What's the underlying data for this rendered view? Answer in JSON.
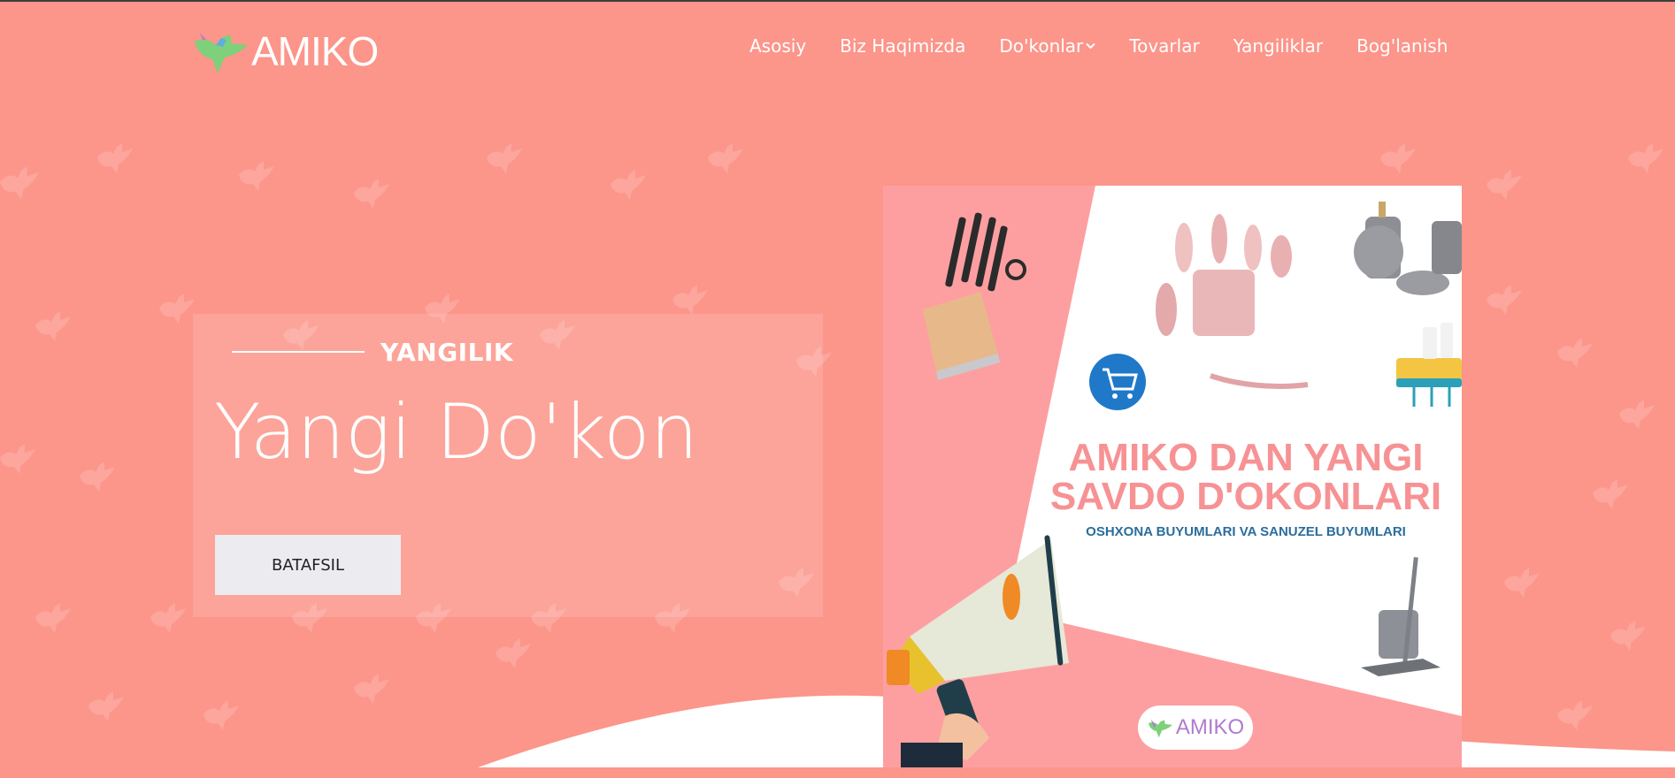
{
  "brand": {
    "logo_text": "AMIKO"
  },
  "nav": {
    "items": [
      {
        "label": "Asosiy"
      },
      {
        "label": "Biz Haqimizda"
      },
      {
        "label": "Do'konlar"
      },
      {
        "label": "Tovarlar"
      },
      {
        "label": "Yangiliklar"
      },
      {
        "label": "Bog'lanish"
      }
    ]
  },
  "hero": {
    "eyebrow": "YANGILIK",
    "title": "Yangi Do'kon",
    "button_label": "BATAFSIL"
  },
  "poster": {
    "headline_line1": "AMIKO DAN YANGI",
    "headline_line2": "SAVDO D'OKONLARI",
    "subline": "OSHXONA BUYUMLARI VA SANUZEL BUYUMLARI",
    "logo_text": "AMIKO"
  },
  "colors": {
    "background": "#fc958a",
    "poster_pink": "#fd9fa0",
    "headline": "#f79294",
    "subline": "#2a6d9c",
    "cart_blue": "#1f79c8"
  }
}
